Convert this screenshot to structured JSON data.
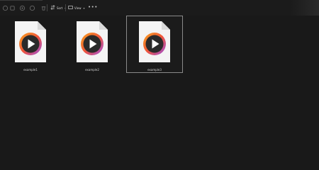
{
  "toolbar": {
    "icons": [
      "new-icon",
      "cut-icon",
      "copy-icon",
      "paste-icon",
      "rename-icon",
      "delete-icon"
    ],
    "sort_label": "Sort",
    "view_label": "View",
    "more_label": "•••"
  },
  "files": [
    {
      "name": "example1",
      "selected": false
    },
    {
      "name": "example2",
      "selected": false
    },
    {
      "name": "example3",
      "selected": true
    }
  ],
  "colors": {
    "background": "#191919",
    "accent_orange": "#f36a2b",
    "accent_purple": "#9a4fe0",
    "selection_border": "#8a8a8a"
  }
}
